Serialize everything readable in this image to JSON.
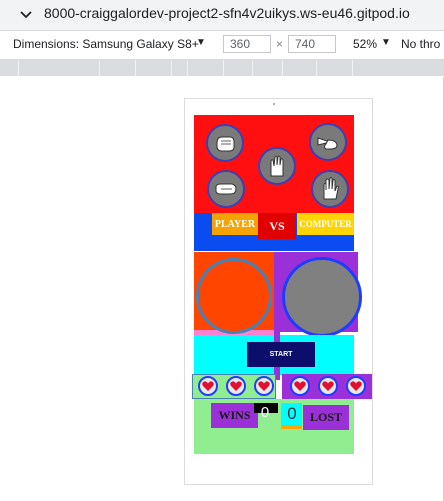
{
  "browser": {
    "url": "8000-craiggalordev-project2-sfn4v2uikys.ws-eu46.gitpod.io"
  },
  "devtools": {
    "dimensions_label": "Dimensions: Samsung Galaxy S8+",
    "width": "360",
    "separator": "×",
    "height": "740",
    "zoom": "52%",
    "throttle": "No thro"
  },
  "game": {
    "choices": [
      "rock-icon",
      "scissors-icon",
      "spock-icon",
      "lizard-icon",
      "paper-icon"
    ],
    "player_label": "PLAYER",
    "vs_label": "VS",
    "computer_label": "COMPUTER",
    "start_label": "START",
    "player_lives": 3,
    "computer_lives": 3,
    "wins_label": "WINS",
    "wins_count": "0",
    "lost_count": "0",
    "lost_label": "LOST",
    "colors": {
      "choices_bg": "#ff0f0f",
      "vs_bar": "#0a4cf0",
      "player_area": "#ff4500",
      "computer_area": "#9b30d9",
      "cyan_area": "#00ffff",
      "bottom_area": "#90ee90",
      "heart": "#e01030"
    }
  }
}
